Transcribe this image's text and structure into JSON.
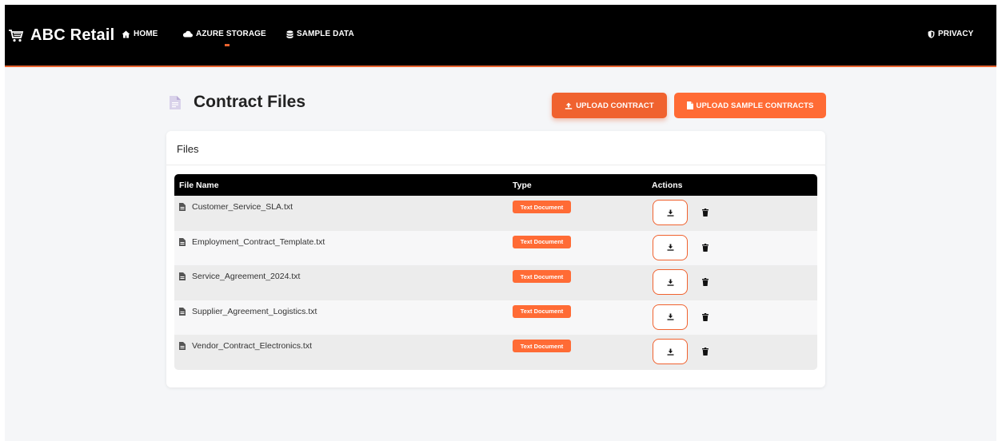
{
  "nav": {
    "brand": "ABC Retail",
    "links": [
      {
        "label": "HOME",
        "icon": "home-icon"
      },
      {
        "label": "AZURE STORAGE",
        "icon": "cloud-icon",
        "active": true
      },
      {
        "label": "SAMPLE DATA",
        "icon": "database-icon"
      }
    ],
    "privacy": "PRIVACY"
  },
  "page": {
    "title": "Contract Files",
    "upload_label": "UPLOAD CONTRACT",
    "upload_sample_label": "UPLOAD SAMPLE CONTRACTS"
  },
  "card": {
    "title": "Files",
    "columns": [
      "File Name",
      "Type",
      "Actions"
    ],
    "rows": [
      {
        "name": "Customer_Service_SLA.txt",
        "type": "Text Document"
      },
      {
        "name": "Employment_Contract_Template.txt",
        "type": "Text Document"
      },
      {
        "name": "Service_Agreement_2024.txt",
        "type": "Text Document"
      },
      {
        "name": "Supplier_Agreement_Logistics.txt",
        "type": "Text Document"
      },
      {
        "name": "Vendor_Contract_Electronics.txt",
        "type": "Text Document"
      }
    ]
  },
  "colors": {
    "accent": "#ff6b35",
    "navbar": "#000000",
    "background": "#f5f6f8"
  }
}
